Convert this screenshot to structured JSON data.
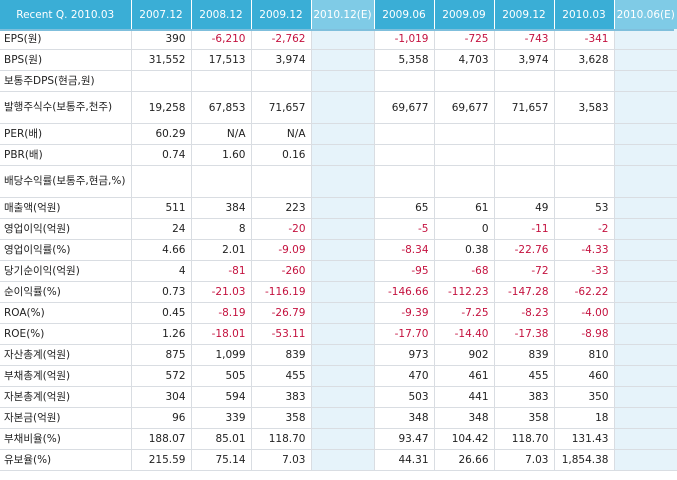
{
  "header": [
    "Recent Q. 2010.03",
    "2007.12",
    "2008.12",
    "2009.12",
    "2010.12(E)",
    "2009.06",
    "2009.09",
    "2009.12",
    "2010.03",
    "2010.06(E)"
  ],
  "rows": [
    {
      "label": "EPS(원)",
      "values": [
        "390",
        "-6,210",
        "-2,762",
        "",
        "-1,019",
        "-725",
        "-743",
        "-341",
        ""
      ]
    },
    {
      "label": "BPS(원)",
      "values": [
        "31,552",
        "17,513",
        "3,974",
        "",
        "5,358",
        "4,703",
        "3,974",
        "3,628",
        ""
      ]
    },
    {
      "label": "보통주DPS(현금,원)",
      "values": [
        "",
        "",
        "",
        "",
        "",
        "",
        "",
        "",
        ""
      ]
    },
    {
      "label": "발행주식수(보통주,천주)",
      "values": [
        "19,258",
        "67,853",
        "71,657",
        "",
        "69,677",
        "69,677",
        "71,657",
        "3,583",
        ""
      ]
    },
    {
      "label": "PER(배)",
      "values": [
        "60.29",
        "N/A",
        "N/A",
        "",
        "",
        "",
        "",
        "",
        ""
      ]
    },
    {
      "label": "PBR(배)",
      "values": [
        "0.74",
        "1.60",
        "0.16",
        "",
        "",
        "",
        "",
        "",
        ""
      ]
    },
    {
      "label": "배당수익률(보통주,현금,%)",
      "values": [
        "",
        "",
        "",
        "",
        "",
        "",
        "",
        "",
        ""
      ]
    },
    {
      "label": "매출액(억원)",
      "values": [
        "511",
        "384",
        "223",
        "",
        "65",
        "61",
        "49",
        "53",
        ""
      ]
    },
    {
      "label": "영업이익(억원)",
      "values": [
        "24",
        "8",
        "-20",
        "",
        "-5",
        "0",
        "-11",
        "-2",
        ""
      ]
    },
    {
      "label": "영업이익률(%)",
      "values": [
        "4.66",
        "2.01",
        "-9.09",
        "",
        "-8.34",
        "0.38",
        "-22.76",
        "-4.33",
        ""
      ]
    },
    {
      "label": "당기순이익(억원)",
      "values": [
        "4",
        "-81",
        "-260",
        "",
        "-95",
        "-68",
        "-72",
        "-33",
        ""
      ]
    },
    {
      "label": "순이익률(%)",
      "values": [
        "0.73",
        "-21.03",
        "-116.19",
        "",
        "-146.66",
        "-112.23",
        "-147.28",
        "-62.22",
        ""
      ]
    },
    {
      "label": "ROA(%)",
      "values": [
        "0.45",
        "-8.19",
        "-26.79",
        "",
        "-9.39",
        "-7.25",
        "-8.23",
        "-4.00",
        ""
      ]
    },
    {
      "label": "ROE(%)",
      "values": [
        "1.26",
        "-18.01",
        "-53.11",
        "",
        "-17.70",
        "-14.40",
        "-17.38",
        "-8.98",
        ""
      ]
    },
    {
      "label": "자산총계(억원)",
      "values": [
        "875",
        "1,099",
        "839",
        "",
        "973",
        "902",
        "839",
        "810",
        ""
      ]
    },
    {
      "label": "부채총계(억원)",
      "values": [
        "572",
        "505",
        "455",
        "",
        "470",
        "461",
        "455",
        "460",
        ""
      ]
    },
    {
      "label": "자본총계(억원)",
      "values": [
        "304",
        "594",
        "383",
        "",
        "503",
        "441",
        "383",
        "350",
        ""
      ]
    },
    {
      "label": "자본금(억원)",
      "values": [
        "96",
        "339",
        "358",
        "",
        "348",
        "348",
        "358",
        "18",
        ""
      ]
    },
    {
      "label": "부채비율(%)",
      "values": [
        "188.07",
        "85.01",
        "118.70",
        "",
        "93.47",
        "104.42",
        "118.70",
        "131.43",
        ""
      ]
    },
    {
      "label": "유보율(%)",
      "values": [
        "215.59",
        "75.14",
        "7.03",
        "",
        "44.31",
        "26.66",
        "7.03",
        "1,854.38",
        ""
      ]
    }
  ],
  "colors": {
    "header_bg": "#3aaed6",
    "estimate_bg": "#e6f3fa",
    "negative": "#c4123f"
  }
}
